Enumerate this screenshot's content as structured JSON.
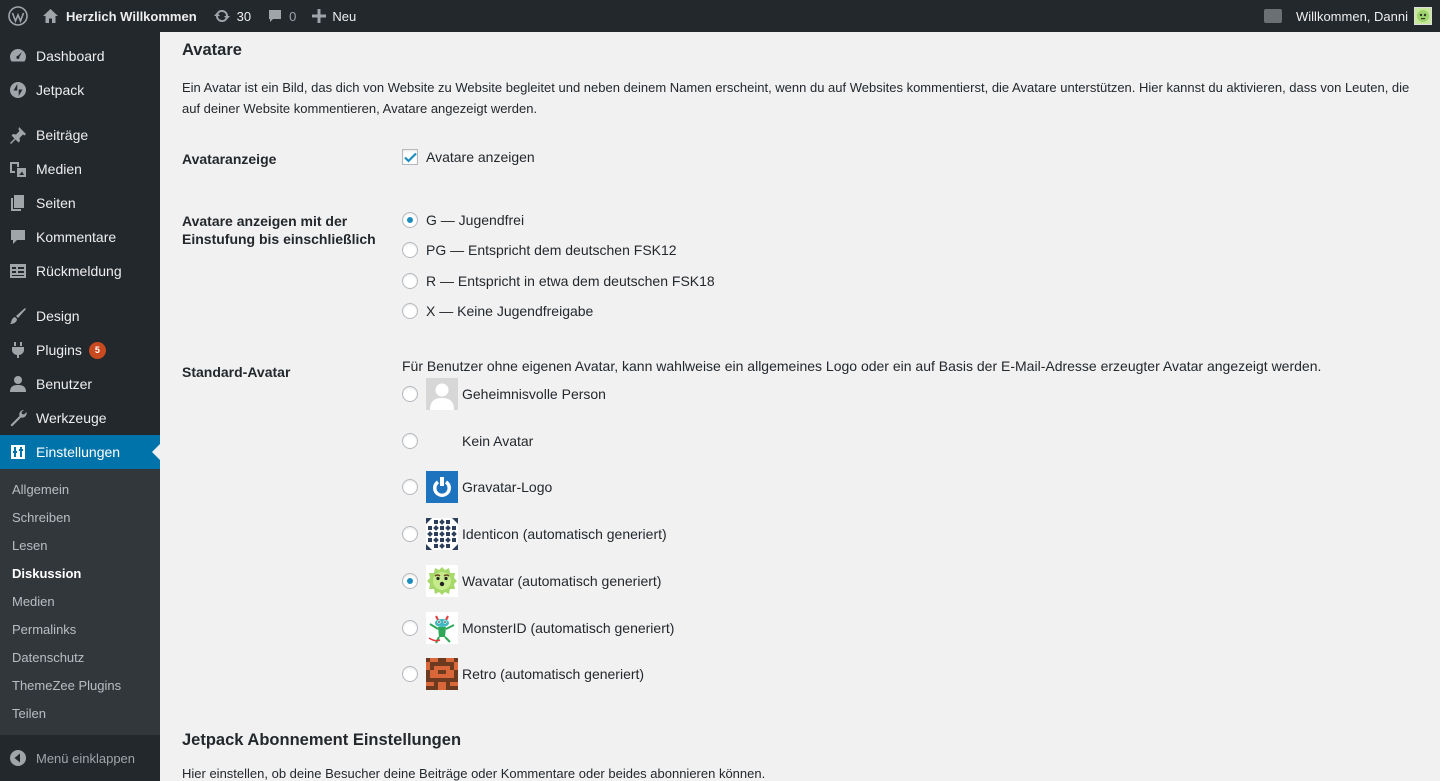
{
  "adminbar": {
    "site_name": "Herzlich Willkommen",
    "updates_count": "30",
    "comments_count": "0",
    "new_label": "Neu",
    "account_label": "Willkommen, Danni"
  },
  "sidebar": {
    "items": [
      {
        "label": "Dashboard",
        "icon": "dashboard-icon"
      },
      {
        "label": "Jetpack",
        "icon": "jetpack-icon"
      },
      {
        "label": "Beiträge",
        "icon": "pin-icon"
      },
      {
        "label": "Medien",
        "icon": "media-icon"
      },
      {
        "label": "Seiten",
        "icon": "pages-icon"
      },
      {
        "label": "Kommentare",
        "icon": "comment-icon"
      },
      {
        "label": "Rückmeldung",
        "icon": "feedback-icon"
      },
      {
        "label": "Design",
        "icon": "brush-icon"
      },
      {
        "label": "Plugins",
        "icon": "plugin-icon",
        "badge": "5"
      },
      {
        "label": "Benutzer",
        "icon": "user-icon"
      },
      {
        "label": "Werkzeuge",
        "icon": "wrench-icon"
      },
      {
        "label": "Einstellungen",
        "icon": "settings-icon"
      }
    ],
    "submenu": [
      "Allgemein",
      "Schreiben",
      "Lesen",
      "Diskussion",
      "Medien",
      "Permalinks",
      "Datenschutz",
      "ThemeZee Plugins",
      "Teilen"
    ],
    "collapse_label": "Menü einklappen"
  },
  "main": {
    "section_title": "Avatare",
    "intro": "Ein Avatar ist ein Bild, das dich von Website zu Website begleitet und neben deinem Namen erscheint, wenn du auf Websites kommentierst, die Avatare unterstützen. Hier kannst du aktivieren, dass von Leuten, die auf deiner Website kommentieren, Avatare angezeigt werden.",
    "display": {
      "label": "Avataranzeige",
      "checkbox_label": "Avatare anzeigen",
      "checked": true
    },
    "rating": {
      "label": "Avatare anzeigen mit der Einstufung bis einschließlich",
      "options": [
        "G — Jugendfrei",
        "PG — Entspricht dem deutschen FSK12",
        "R — Entspricht in etwa dem deutschen FSK18",
        "X — Keine Jugendfreigabe"
      ],
      "selected": 0
    },
    "default_avatar": {
      "label": "Standard-Avatar",
      "description": "Für Benutzer ohne eigenen Avatar, kann wahlweise ein allgemeines Logo oder ein auf Basis der E-Mail-Adresse erzeugter Avatar angezeigt werden.",
      "options": [
        {
          "label": "Geheimnisvolle Person",
          "icon": "mystery-person-avatar"
        },
        {
          "label": "Kein Avatar",
          "icon": "blank-avatar"
        },
        {
          "label": "Gravatar-Logo",
          "icon": "gravatar-logo-avatar"
        },
        {
          "label": "Identicon (automatisch generiert)",
          "icon": "identicon-avatar"
        },
        {
          "label": "Wavatar (automatisch generiert)",
          "icon": "wavatar-avatar"
        },
        {
          "label": "MonsterID (automatisch generiert)",
          "icon": "monsterid-avatar"
        },
        {
          "label": "Retro (automatisch generiert)",
          "icon": "retro-avatar"
        }
      ],
      "selected": 4
    },
    "jetpack": {
      "title": "Jetpack Abonnement Einstellungen",
      "description": "Hier einstellen, ob deine Besucher deine Beiträge oder Kommentare oder beides abonnieren können."
    }
  },
  "colors": {
    "adminbar_bg": "#23282d",
    "sidebar_bg": "#23282d",
    "submenu_bg": "#32373c",
    "accent": "#0073aa",
    "badge": "#ca4a1f",
    "page_bg": "#f1f1f1"
  }
}
